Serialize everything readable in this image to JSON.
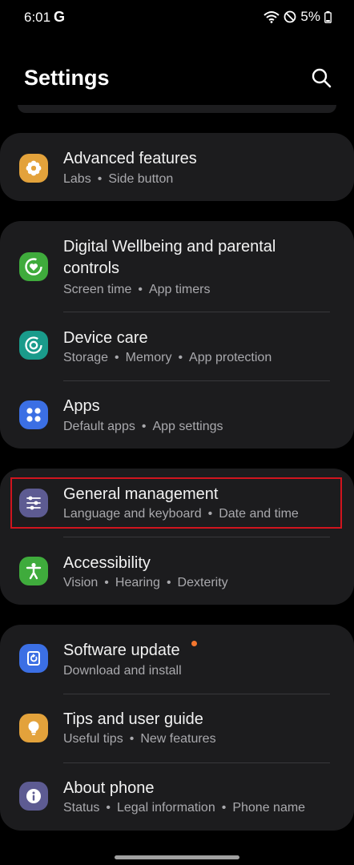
{
  "status_bar": {
    "time": "6:01",
    "carrier_icon": "G",
    "battery": "5%"
  },
  "header": {
    "title": "Settings"
  },
  "groups": [
    {
      "items": [
        {
          "icon": "labs-flower-icon",
          "color": "#e3a23b",
          "title": "Advanced features",
          "subs": [
            "Labs",
            "Side button"
          ]
        }
      ]
    },
    {
      "items": [
        {
          "icon": "wellbeing-heart-icon",
          "color": "#3fab3c",
          "title_lines": [
            "Digital Wellbeing and parental",
            "controls"
          ],
          "subs": [
            "Screen time",
            "App timers"
          ]
        },
        {
          "icon": "device-care-icon",
          "color": "#1a9b8b",
          "title": "Device care",
          "subs": [
            "Storage",
            "Memory",
            "App protection"
          ]
        },
        {
          "icon": "apps-grid-icon",
          "color": "#3b6fe4",
          "title": "Apps",
          "subs": [
            "Default apps",
            "App settings"
          ]
        }
      ]
    },
    {
      "items": [
        {
          "icon": "sliders-icon",
          "color": "#5d5b92",
          "title": "General management",
          "subs": [
            "Language and keyboard",
            "Date and time"
          ],
          "highlighted": true
        },
        {
          "icon": "accessibility-icon",
          "color": "#3fab3c",
          "title": "Accessibility",
          "subs": [
            "Vision",
            "Hearing",
            "Dexterity"
          ]
        }
      ]
    },
    {
      "items": [
        {
          "icon": "software-update-icon",
          "color": "#3b6fe4",
          "title": "Software update",
          "subs": [
            "Download and install"
          ],
          "badge": true
        },
        {
          "icon": "lightbulb-icon",
          "color": "#e3a23b",
          "title": "Tips and user guide",
          "subs": [
            "Useful tips",
            "New features"
          ]
        },
        {
          "icon": "info-icon",
          "color": "#5d5b92",
          "title": "About phone",
          "subs": [
            "Status",
            "Legal information",
            "Phone name"
          ]
        }
      ]
    }
  ],
  "colors": {
    "background": "#000000",
    "card": "#1c1c1e",
    "highlight_border": "#d0141e",
    "badge": "#f4762e"
  }
}
